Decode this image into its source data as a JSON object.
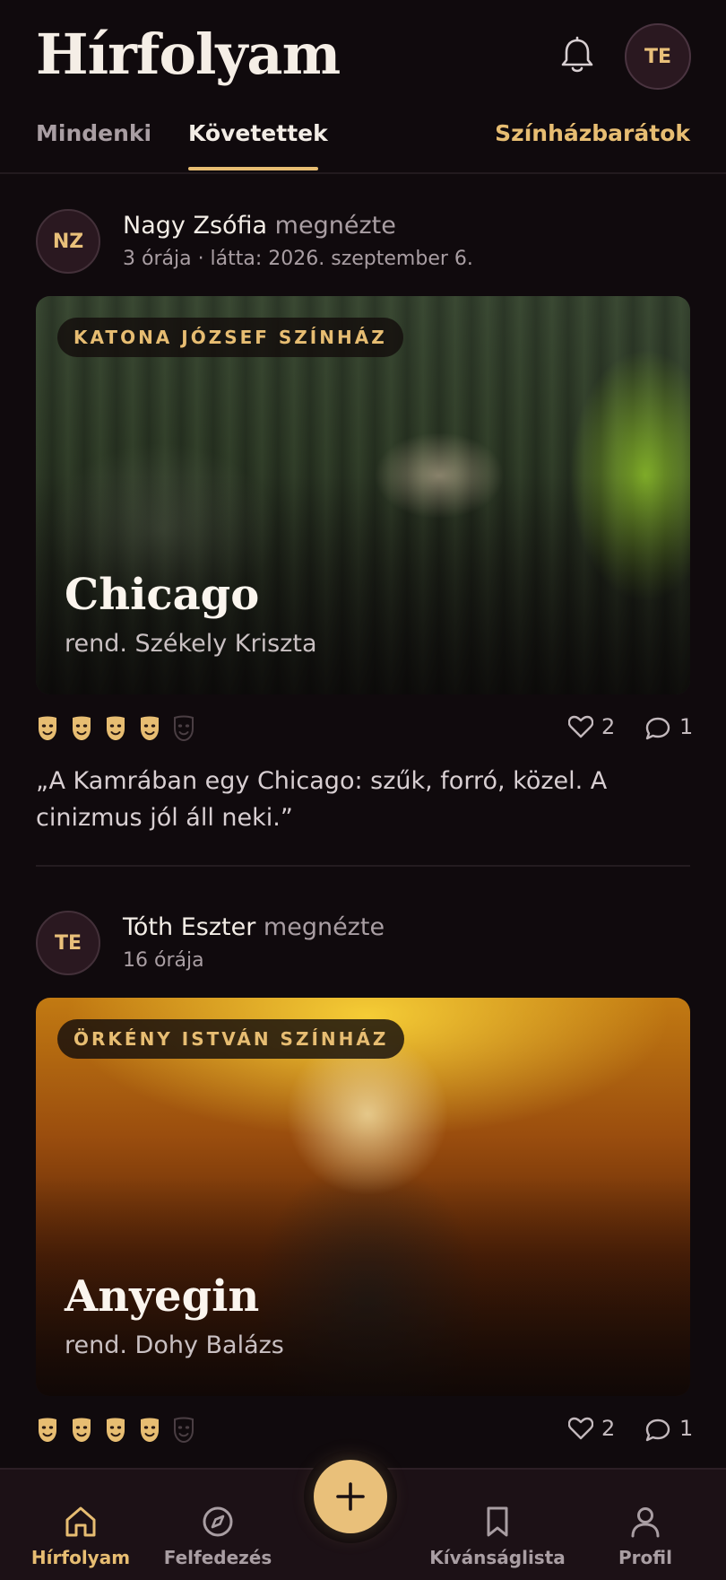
{
  "header": {
    "title": "Hírfolyam",
    "user_initials": "TE"
  },
  "tabs": [
    {
      "label": "Mindenki",
      "active": false
    },
    {
      "label": "Követettek",
      "active": true
    },
    {
      "label": "Színházbarátok",
      "active": false
    }
  ],
  "posts": [
    {
      "initials": "NZ",
      "name": "Nagy Zsófia",
      "action": "megnézte",
      "meta": "3 órája · látta: 2026. szeptember 6.",
      "venue": "KATONA JÓZSEF SZÍNHÁZ",
      "play_title": "Chicago",
      "director": "rend. Székely Kriszta",
      "rating": 4,
      "rating_max": 5,
      "likes": "2",
      "comments": "1",
      "quote": "„A Kamrában egy Chicago: szűk, forró, közel. A cinizmus jól áll neki.”"
    },
    {
      "initials": "TE",
      "name": "Tóth Eszter",
      "action": "megnézte",
      "meta": "16 órája",
      "venue": "ÖRKÉNY ISTVÁN SZÍNHÁZ",
      "play_title": "Anyegin",
      "director": "rend. Dohy Balázs",
      "rating": 4,
      "rating_max": 5,
      "likes": "2",
      "comments": "1"
    }
  ],
  "bottom_nav": [
    {
      "label": "Hírfolyam",
      "icon": "home-icon",
      "active": true
    },
    {
      "label": "Felfedezés",
      "icon": "compass-icon",
      "active": false
    },
    {
      "label": "Kívánságlista",
      "icon": "bookmark-icon",
      "active": false
    },
    {
      "label": "Profil",
      "icon": "person-icon",
      "active": false
    }
  ],
  "fab": {
    "icon": "plus-icon"
  },
  "colors": {
    "background": "#100a0d",
    "accent": "#e7bd72",
    "muted_text": "#a99ea3",
    "nav_background": "#1c1116"
  }
}
